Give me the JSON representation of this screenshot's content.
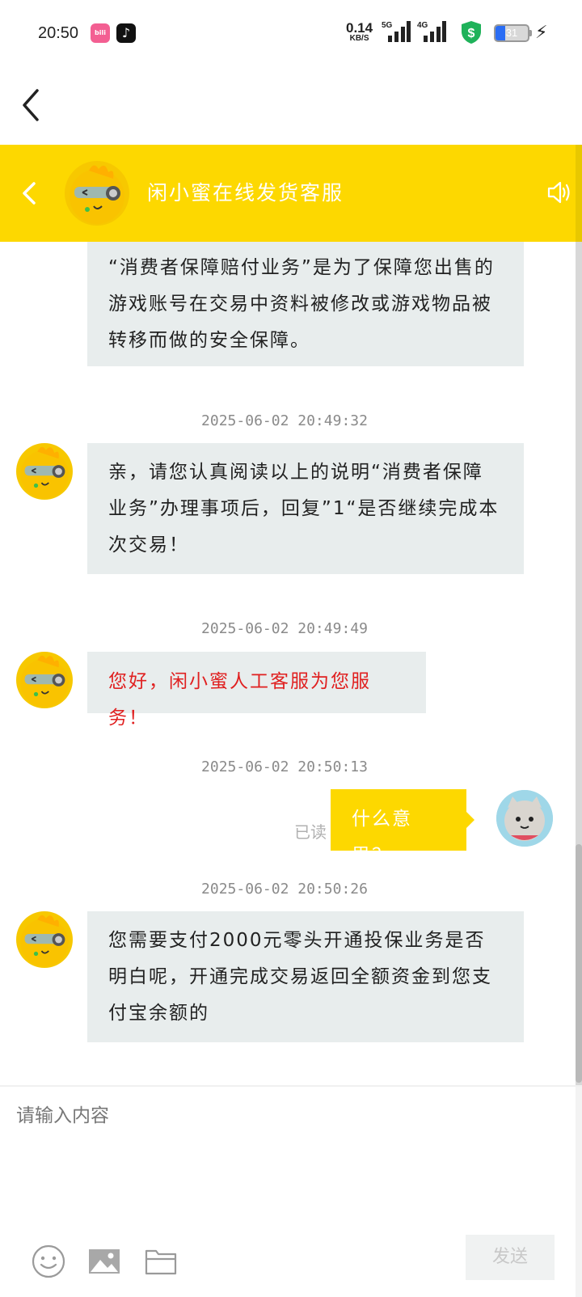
{
  "status_bar": {
    "time": "20:50",
    "net_speed_value": "0.14",
    "net_speed_unit": "KB/S",
    "sig1_label": "5G",
    "sig2_label": "4G",
    "battery_level": "31",
    "battery_fraction": 0.31,
    "app_icons": [
      "bilibili-icon",
      "tiktok-icon"
    ]
  },
  "header": {
    "title": "闲小蜜在线发货客服"
  },
  "messages": {
    "m0_text": "“消费者保障赔付业务”是为了保障您出售的游戏账号在交易中资料被修改或游戏物品被转移而做的安全保障。",
    "t1": "2025-06-02 20:49:32",
    "m1_text": "亲，请您认真阅读以上的说明“消费者保障业务”办理事项后，回复”1“是否继续完成本次交易！",
    "t2": "2025-06-02 20:49:49",
    "m2_text": "您好，闲小蜜人工客服为您服务！",
    "t3": "2025-06-02 20:50:13",
    "m3_text": "什么意思？",
    "m3_read": "已读",
    "t4": "2025-06-02 20:50:26",
    "m4_text": "您需要支付2000元零头开通投保业务是否明白呢，开通完成交易返回全额资金到您支付宝余额的"
  },
  "input": {
    "placeholder": "请输入内容",
    "send_label": "发送"
  },
  "colors": {
    "brand_yellow": "#fdd800",
    "bubble_gray": "#e8eded",
    "alert_red": "#e02020",
    "timestamp_gray": "#8a8a8a"
  }
}
